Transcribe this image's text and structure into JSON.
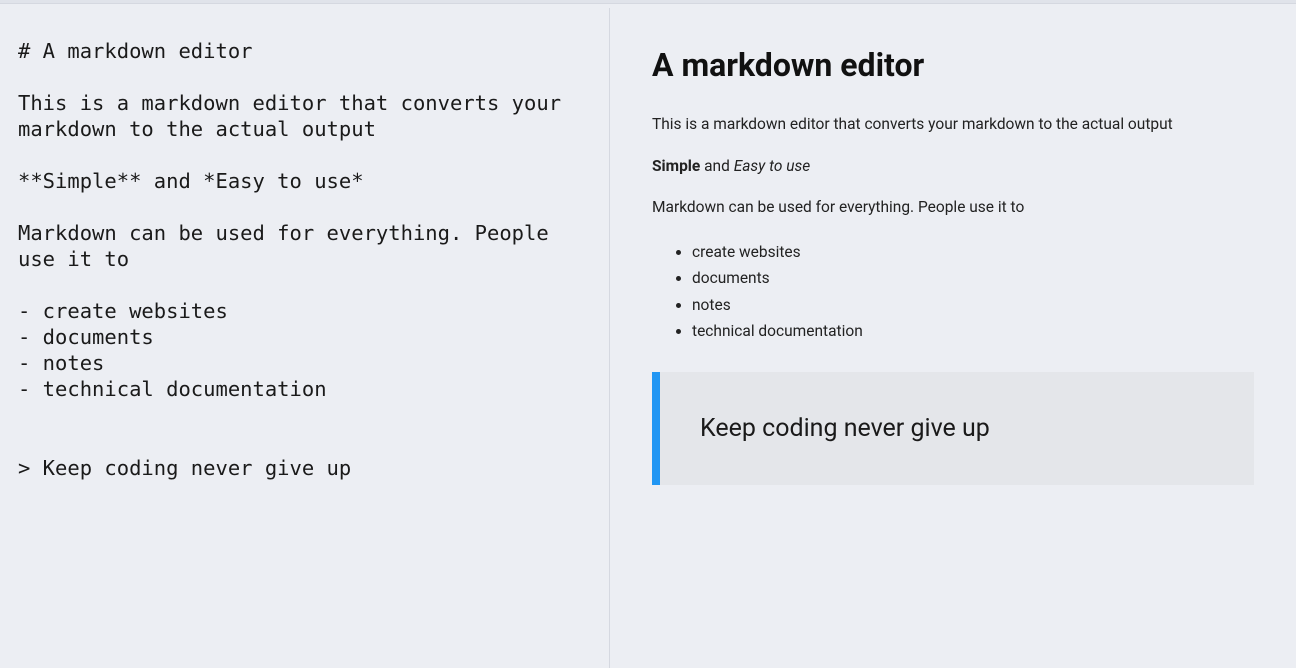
{
  "editor": {
    "raw_markdown": "# A markdown editor\n\nThis is a markdown editor that converts your markdown to the actual output\n\n**Simple** and *Easy to use*\n\nMarkdown can be used for everything. People use it to\n\n- create websites\n- documents\n- notes\n- technical documentation\n\n\n> Keep coding never give up"
  },
  "preview": {
    "title": "A markdown editor",
    "intro_paragraph": "This is a markdown editor that converts your markdown to the actual output",
    "simple_word": "Simple",
    "and_word": " and ",
    "easy_phrase": "Easy to use",
    "usage_paragraph": "Markdown can be used for everything. People use it to",
    "list_items": {
      "0": "create websites",
      "1": "documents",
      "2": "notes",
      "3": "technical documentation"
    },
    "blockquote_text": "Keep coding never give up"
  }
}
